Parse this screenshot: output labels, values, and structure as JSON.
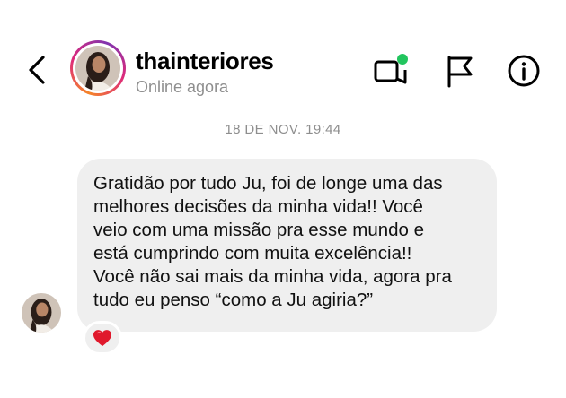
{
  "header": {
    "username": "thainteriores",
    "status": "Online agora",
    "back_icon": "chevron-left-icon",
    "video_icon": "video-call-icon",
    "flag_icon": "flag-icon",
    "info_icon": "info-icon",
    "online_dot_color": "#22c55e"
  },
  "conversation": {
    "timestamp": "18 DE NOV. 19:44",
    "message": {
      "lines": [
        "Gratidão por tudo Ju, foi de longe uma das",
        "melhores decisões da minha vida!! Você",
        "veio com uma missão pra esse mundo e",
        "está cumprindo com muita excelência!!",
        "Você não sai mais da minha vida, agora pra",
        "tudo eu penso “como a Ju agiria?”"
      ],
      "reaction": "❤️"
    }
  }
}
